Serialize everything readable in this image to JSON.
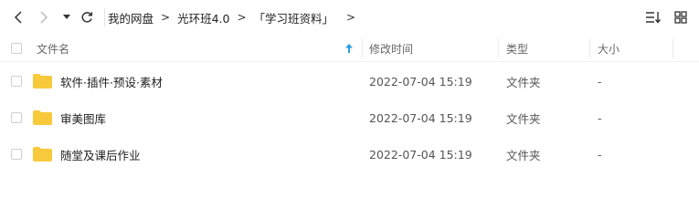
{
  "toolbar": {
    "breadcrumbs": [
      "我的网盘",
      "光环班4.0",
      "「学习班资料」"
    ],
    "separator": ">",
    "trailing_separator": ">"
  },
  "table": {
    "columns": {
      "name": "文件名",
      "modified": "修改时间",
      "type": "类型",
      "size": "大小"
    },
    "rows": [
      {
        "name": "软件·插件·预设·素材",
        "modified": "2022-07-04 15:19",
        "type": "文件夹",
        "size": "-"
      },
      {
        "name": "审美图库",
        "modified": "2022-07-04 15:19",
        "type": "文件夹",
        "size": "-"
      },
      {
        "name": "随堂及课后作业",
        "modified": "2022-07-04 15:19",
        "type": "文件夹",
        "size": "-"
      }
    ]
  },
  "colors": {
    "folder": "#f8c93a",
    "sort_arrow": "#2a9ce0"
  }
}
